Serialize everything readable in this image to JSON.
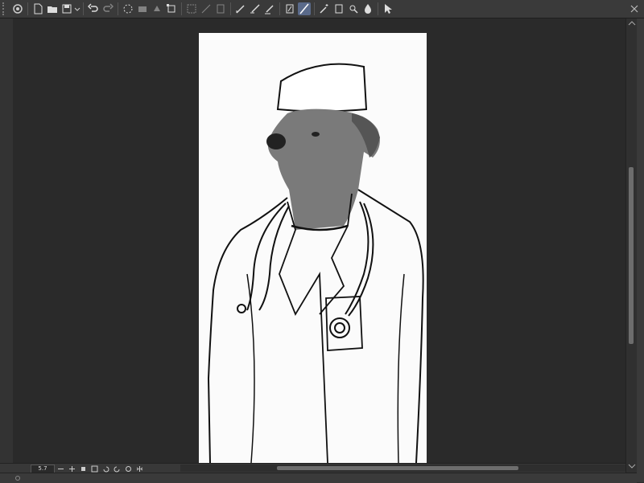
{
  "toolbar": {
    "tools": [
      {
        "name": "app-icon"
      },
      {
        "name": "new-file-icon"
      },
      {
        "name": "open-folder-icon"
      },
      {
        "name": "save-icon"
      },
      {
        "name": "undo-icon"
      },
      {
        "name": "redo-icon"
      },
      {
        "name": "loading-icon"
      },
      {
        "name": "erase-icon"
      },
      {
        "name": "transform-icon"
      },
      {
        "name": "selection-icon"
      },
      {
        "name": "lasso-icon"
      },
      {
        "name": "pen-icon"
      },
      {
        "name": "brush-icon"
      },
      {
        "name": "ruler-icon"
      },
      {
        "name": "line-icon"
      },
      {
        "name": "magic-wand-icon"
      },
      {
        "name": "layer-icon"
      },
      {
        "name": "eyedropper-icon"
      },
      {
        "name": "fill-icon"
      },
      {
        "name": "cursor-icon"
      }
    ]
  },
  "status": {
    "zoom": "5.7"
  },
  "colors": {
    "background": "#2b2b2b",
    "toolbar": "#3a3a3a",
    "active_tool": "#5a6a8a",
    "canvas": "#fbfbfb"
  }
}
